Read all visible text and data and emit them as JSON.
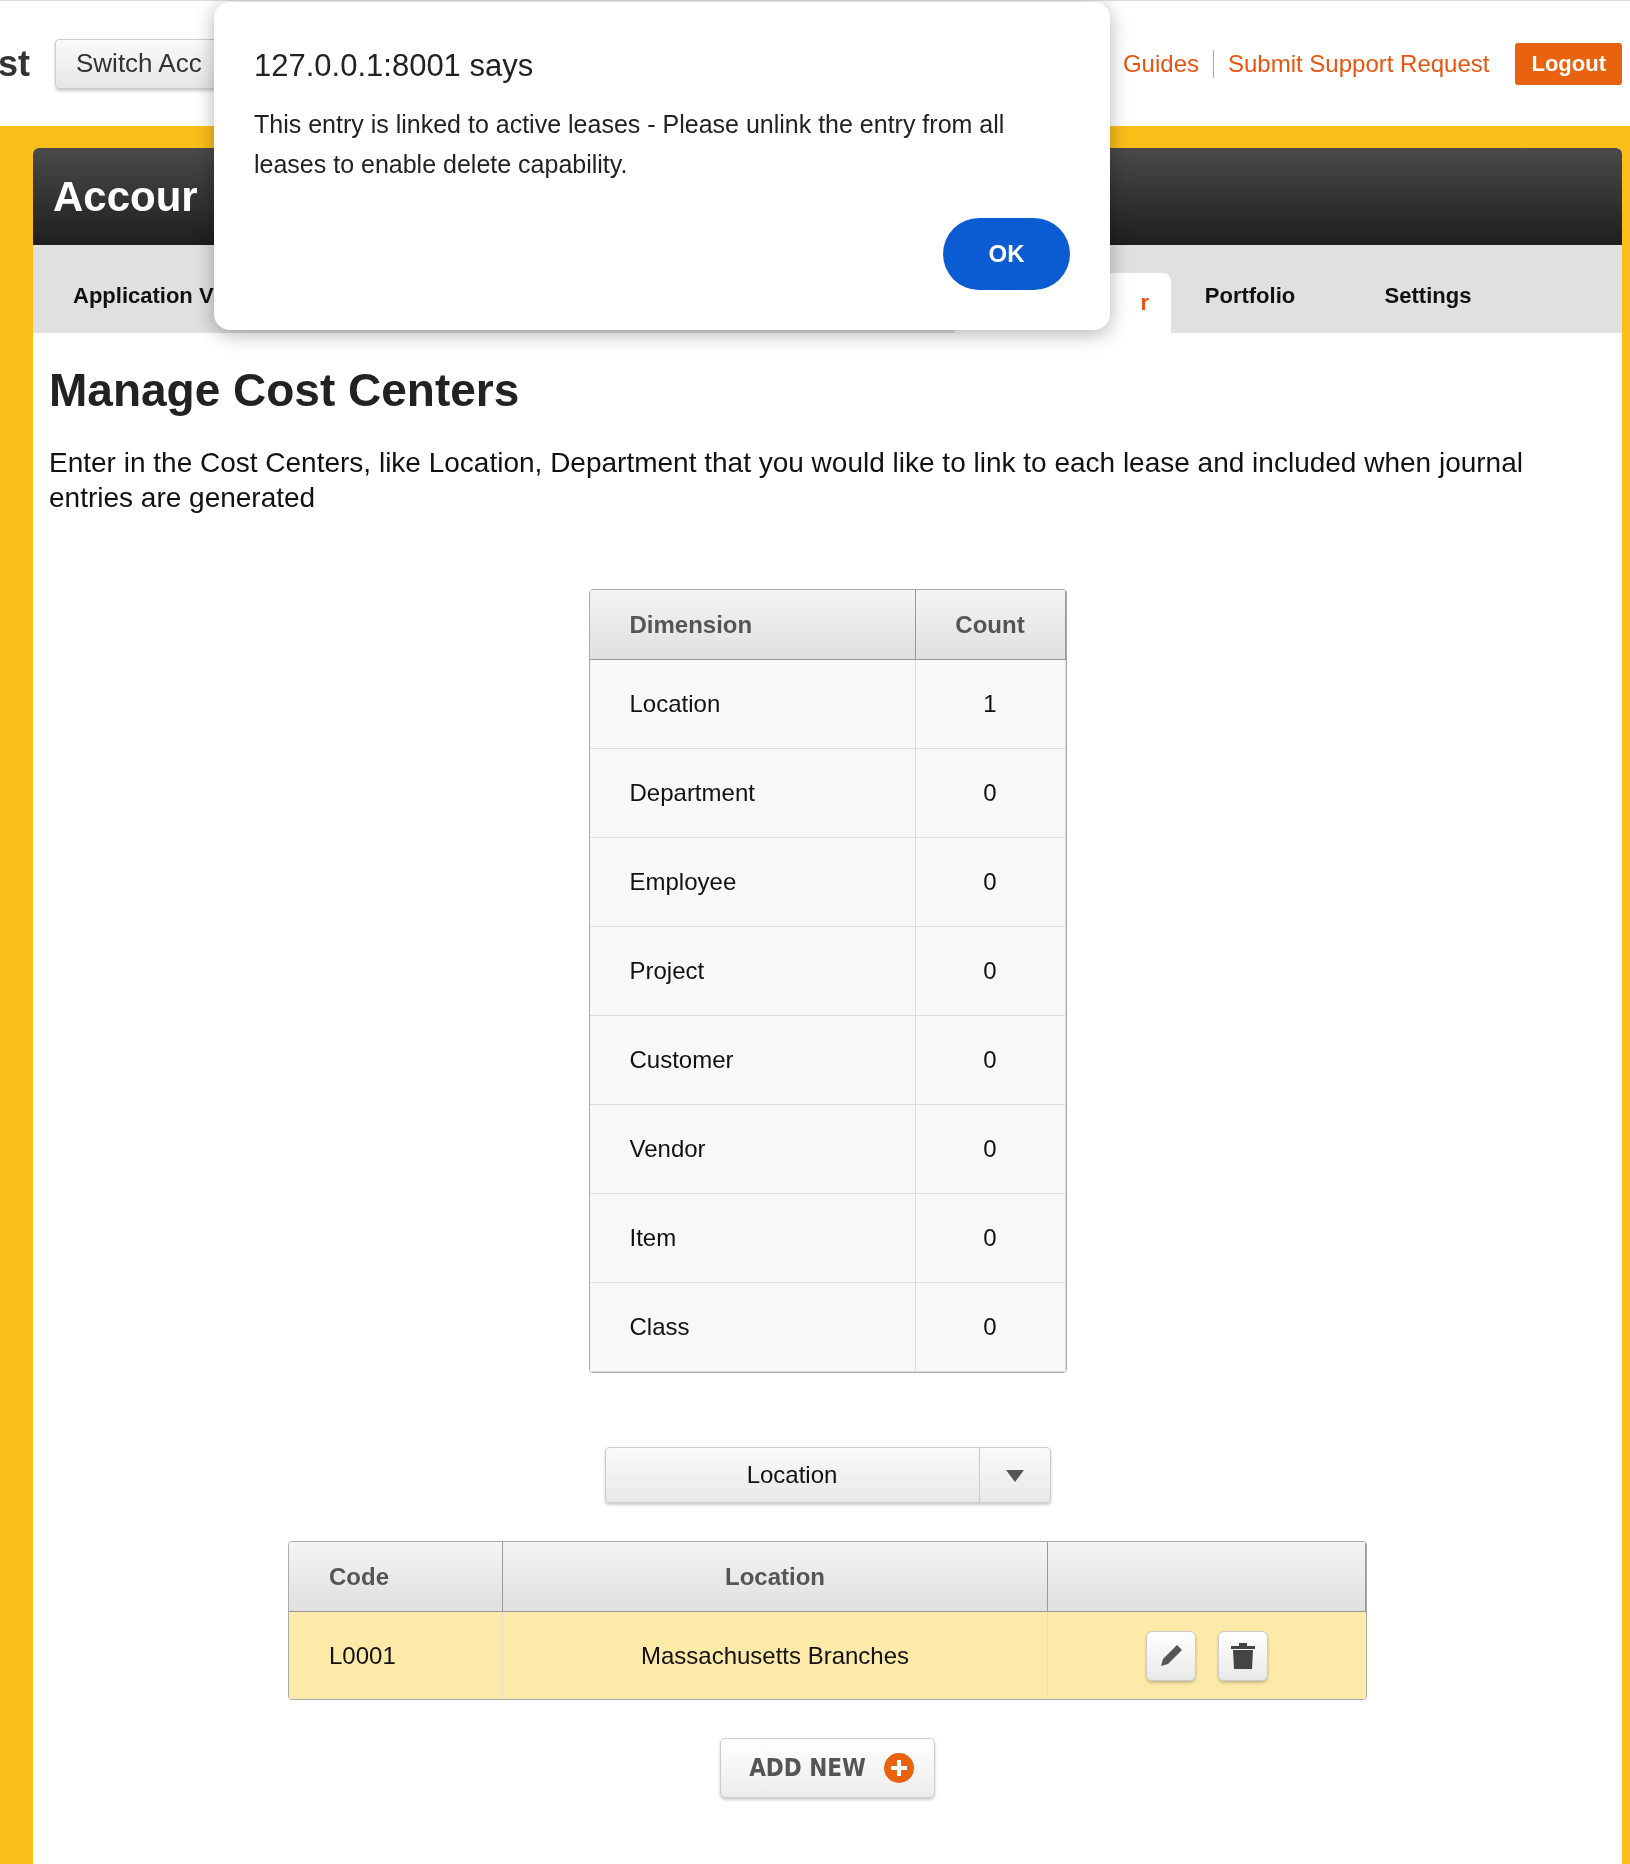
{
  "header": {
    "brand": "st",
    "switch_button": "Switch Acc",
    "links": [
      "Guides",
      "Submit Support Request"
    ],
    "logout": "Logout"
  },
  "panel": {
    "title": "Accour",
    "tabs": [
      {
        "label": "Application V",
        "selected": false
      },
      {
        "label": "r",
        "selected": true
      },
      {
        "label": "Portfolio",
        "selected": false
      },
      {
        "label": "Settings",
        "selected": false
      }
    ]
  },
  "page": {
    "title": "Manage Cost Centers",
    "description": "Enter in the Cost Centers, like Location, Department that you would like to link to each lease and included when journal entries are generated"
  },
  "dimension_table": {
    "columns": [
      "Dimension",
      "Count"
    ],
    "rows": [
      [
        "Location",
        "1"
      ],
      [
        "Department",
        "0"
      ],
      [
        "Employee",
        "0"
      ],
      [
        "Project",
        "0"
      ],
      [
        "Customer",
        "0"
      ],
      [
        "Vendor",
        "0"
      ],
      [
        "Item",
        "0"
      ],
      [
        "Class",
        "0"
      ]
    ]
  },
  "dimension_select": {
    "value": "Location"
  },
  "entries_table": {
    "columns": [
      "Code",
      "Location"
    ],
    "rows": [
      {
        "code": "L0001",
        "name": "Massachusetts Branches",
        "selected": true
      }
    ]
  },
  "add_button": "ADD NEW",
  "dialog": {
    "title": "127.0.0.1:8001 says",
    "message": "This entry is linked to active leases - Please unlink the entry from all leases to enable delete capability.",
    "ok": "OK"
  }
}
